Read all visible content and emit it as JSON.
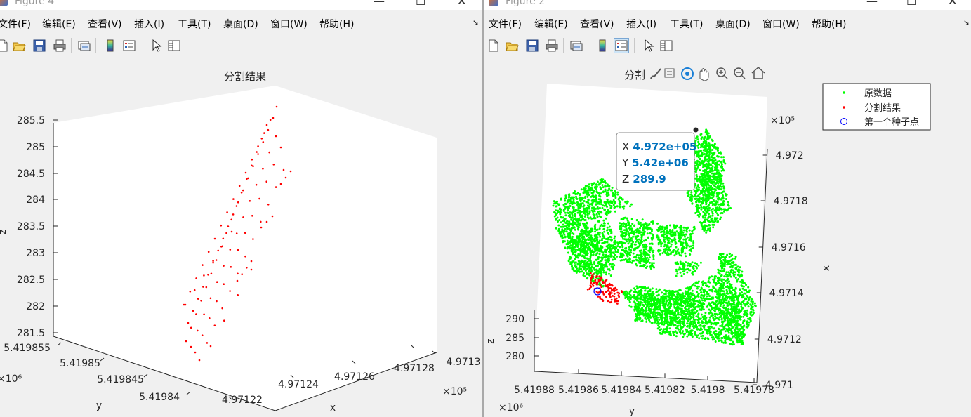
{
  "colors": {
    "window_bg": "#f0f0f0",
    "plot_bg": "#ffffff",
    "segmentation_points": "#ff0000",
    "raw_points": "#00ff00",
    "seed_marker": "#0000ff",
    "datatip_value": "#0072bd",
    "toolbar_pressed": "#cce4f7"
  },
  "menu_labels": [
    "文件(F)",
    "编辑(E)",
    "查看(V)",
    "插入(I)",
    "工具(T)",
    "桌面(D)",
    "窗口(W)",
    "帮助(H)"
  ],
  "menu_overflow_icon": "arrow-down-right-icon",
  "window_controls": {
    "minimize": "—",
    "maximize": "☐",
    "close": "✕"
  },
  "toolbar_icons": [
    "new-figure-icon",
    "open-file-icon",
    "save-icon",
    "print-icon",
    "link-plot-icon",
    "insert-colorbar-icon",
    "insert-legend-icon",
    "edit-plot-icon",
    "property-inspector-icon"
  ],
  "left_window": {
    "title": "Figure 4",
    "axes_title": "分割结果",
    "z_ticks": [
      "285.5",
      "285",
      "284.5",
      "284",
      "283.5",
      "283",
      "282.5",
      "282",
      "281.5"
    ],
    "y_ticks": [
      "5.419855",
      "5.41985",
      "5.419845",
      "5.41984"
    ],
    "x_ticks": [
      "4.97122",
      "4.97124",
      "4.97126",
      "4.97128",
      "4.9713"
    ],
    "y_exponent": "×10⁶",
    "x_exponent": "×10⁵",
    "xlabel": "x",
    "ylabel": "y",
    "zlabel": "z"
  },
  "right_window": {
    "title": "Figure 2",
    "axes_title_partial": "分割",
    "axes_toolbar_icons": [
      "brush-icon",
      "datatip-icon",
      "rotate-3d-icon",
      "pan-icon",
      "zoom-in-icon",
      "zoom-out-icon",
      "home-icon"
    ],
    "z_ticks": [
      "290",
      "285",
      "280"
    ],
    "y_ticks": [
      "5.41988",
      "5.41986",
      "5.41984",
      "5.41982",
      "5.4198",
      "5.41978"
    ],
    "x_ticks": [
      "4.972",
      "4.9718",
      "4.9716",
      "4.9714",
      "4.9712",
      "4.971"
    ],
    "y_exponent": "×10⁶",
    "x_exponent": "×10⁵",
    "xlabel": "x",
    "ylabel": "y",
    "zlabel": "z",
    "legend": [
      "原数据",
      "分割结果",
      "第一个种子点"
    ],
    "datatip": {
      "rows": [
        {
          "axis": "X",
          "value": "4.972e+05"
        },
        {
          "axis": "Y",
          "value": "5.42e+06"
        },
        {
          "axis": "Z",
          "value": "289.9"
        }
      ]
    }
  },
  "chart_data": [
    {
      "type": "scatter",
      "title": "分割结果",
      "xlabel": "x",
      "ylabel": "y",
      "zlabel": "z",
      "xlim": [
        497122,
        497130
      ],
      "ylim": [
        5419840,
        5419855
      ],
      "zlim": [
        281.5,
        285.5
      ],
      "grid": false,
      "series": [
        {
          "point_count_estimate": 120,
          "x_range": [
            497122,
            497130
          ],
          "y_range": [
            5419840,
            5419855
          ],
          "z_range": [
            281.5,
            285.5
          ]
        }
      ]
    },
    {
      "type": "scatter",
      "title": "分割",
      "xlabel": "x",
      "ylabel": "y",
      "zlabel": "z",
      "xlim": [
        497100,
        497200
      ],
      "ylim": [
        5419780,
        5419880
      ],
      "zlim": [
        278,
        292
      ],
      "legend_position": "top-right",
      "grid": false,
      "series": [
        {
          "name": "原数据",
          "point_count_estimate": 2000
        },
        {
          "name": "分割结果",
          "point_count_estimate": 120
        },
        {
          "name": "第一个种子点",
          "point_count_estimate": 1
        }
      ],
      "datatip": {
        "x": 497200,
        "y": 5420000,
        "z": 289.9
      }
    }
  ]
}
